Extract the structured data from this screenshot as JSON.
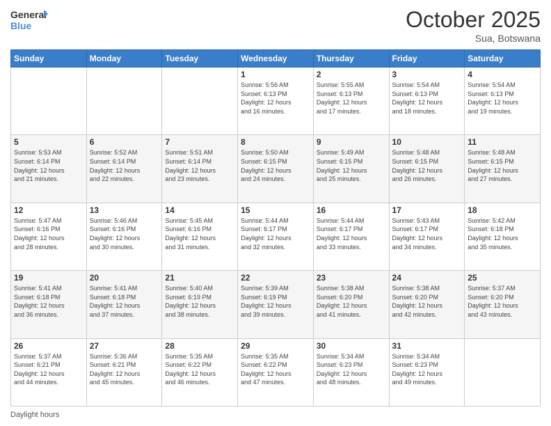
{
  "logo": {
    "line1": "General",
    "line2": "Blue"
  },
  "header": {
    "month": "October 2025",
    "location": "Sua, Botswana"
  },
  "days_of_week": [
    "Sunday",
    "Monday",
    "Tuesday",
    "Wednesday",
    "Thursday",
    "Friday",
    "Saturday"
  ],
  "footer": {
    "daylight_label": "Daylight hours"
  },
  "weeks": [
    [
      {
        "day": "",
        "info": ""
      },
      {
        "day": "",
        "info": ""
      },
      {
        "day": "",
        "info": ""
      },
      {
        "day": "1",
        "info": "Sunrise: 5:56 AM\nSunset: 6:13 PM\nDaylight: 12 hours\nand 16 minutes."
      },
      {
        "day": "2",
        "info": "Sunrise: 5:55 AM\nSunset: 6:13 PM\nDaylight: 12 hours\nand 17 minutes."
      },
      {
        "day": "3",
        "info": "Sunrise: 5:54 AM\nSunset: 6:13 PM\nDaylight: 12 hours\nand 18 minutes."
      },
      {
        "day": "4",
        "info": "Sunrise: 5:54 AM\nSunset: 6:13 PM\nDaylight: 12 hours\nand 19 minutes."
      }
    ],
    [
      {
        "day": "5",
        "info": "Sunrise: 5:53 AM\nSunset: 6:14 PM\nDaylight: 12 hours\nand 21 minutes."
      },
      {
        "day": "6",
        "info": "Sunrise: 5:52 AM\nSunset: 6:14 PM\nDaylight: 12 hours\nand 22 minutes."
      },
      {
        "day": "7",
        "info": "Sunrise: 5:51 AM\nSunset: 6:14 PM\nDaylight: 12 hours\nand 23 minutes."
      },
      {
        "day": "8",
        "info": "Sunrise: 5:50 AM\nSunset: 6:15 PM\nDaylight: 12 hours\nand 24 minutes."
      },
      {
        "day": "9",
        "info": "Sunrise: 5:49 AM\nSunset: 6:15 PM\nDaylight: 12 hours\nand 25 minutes."
      },
      {
        "day": "10",
        "info": "Sunrise: 5:48 AM\nSunset: 6:15 PM\nDaylight: 12 hours\nand 26 minutes."
      },
      {
        "day": "11",
        "info": "Sunrise: 5:48 AM\nSunset: 6:15 PM\nDaylight: 12 hours\nand 27 minutes."
      }
    ],
    [
      {
        "day": "12",
        "info": "Sunrise: 5:47 AM\nSunset: 6:16 PM\nDaylight: 12 hours\nand 28 minutes."
      },
      {
        "day": "13",
        "info": "Sunrise: 5:46 AM\nSunset: 6:16 PM\nDaylight: 12 hours\nand 30 minutes."
      },
      {
        "day": "14",
        "info": "Sunrise: 5:45 AM\nSunset: 6:16 PM\nDaylight: 12 hours\nand 31 minutes."
      },
      {
        "day": "15",
        "info": "Sunrise: 5:44 AM\nSunset: 6:17 PM\nDaylight: 12 hours\nand 32 minutes."
      },
      {
        "day": "16",
        "info": "Sunrise: 5:44 AM\nSunset: 6:17 PM\nDaylight: 12 hours\nand 33 minutes."
      },
      {
        "day": "17",
        "info": "Sunrise: 5:43 AM\nSunset: 6:17 PM\nDaylight: 12 hours\nand 34 minutes."
      },
      {
        "day": "18",
        "info": "Sunrise: 5:42 AM\nSunset: 6:18 PM\nDaylight: 12 hours\nand 35 minutes."
      }
    ],
    [
      {
        "day": "19",
        "info": "Sunrise: 5:41 AM\nSunset: 6:18 PM\nDaylight: 12 hours\nand 36 minutes."
      },
      {
        "day": "20",
        "info": "Sunrise: 5:41 AM\nSunset: 6:18 PM\nDaylight: 12 hours\nand 37 minutes."
      },
      {
        "day": "21",
        "info": "Sunrise: 5:40 AM\nSunset: 6:19 PM\nDaylight: 12 hours\nand 38 minutes."
      },
      {
        "day": "22",
        "info": "Sunrise: 5:39 AM\nSunset: 6:19 PM\nDaylight: 12 hours\nand 39 minutes."
      },
      {
        "day": "23",
        "info": "Sunrise: 5:38 AM\nSunset: 6:20 PM\nDaylight: 12 hours\nand 41 minutes."
      },
      {
        "day": "24",
        "info": "Sunrise: 5:38 AM\nSunset: 6:20 PM\nDaylight: 12 hours\nand 42 minutes."
      },
      {
        "day": "25",
        "info": "Sunrise: 5:37 AM\nSunset: 6:20 PM\nDaylight: 12 hours\nand 43 minutes."
      }
    ],
    [
      {
        "day": "26",
        "info": "Sunrise: 5:37 AM\nSunset: 6:21 PM\nDaylight: 12 hours\nand 44 minutes."
      },
      {
        "day": "27",
        "info": "Sunrise: 5:36 AM\nSunset: 6:21 PM\nDaylight: 12 hours\nand 45 minutes."
      },
      {
        "day": "28",
        "info": "Sunrise: 5:35 AM\nSunset: 6:22 PM\nDaylight: 12 hours\nand 46 minutes."
      },
      {
        "day": "29",
        "info": "Sunrise: 5:35 AM\nSunset: 6:22 PM\nDaylight: 12 hours\nand 47 minutes."
      },
      {
        "day": "30",
        "info": "Sunrise: 5:34 AM\nSunset: 6:23 PM\nDaylight: 12 hours\nand 48 minutes."
      },
      {
        "day": "31",
        "info": "Sunrise: 5:34 AM\nSunset: 6:23 PM\nDaylight: 12 hours\nand 49 minutes."
      },
      {
        "day": "",
        "info": ""
      }
    ]
  ]
}
